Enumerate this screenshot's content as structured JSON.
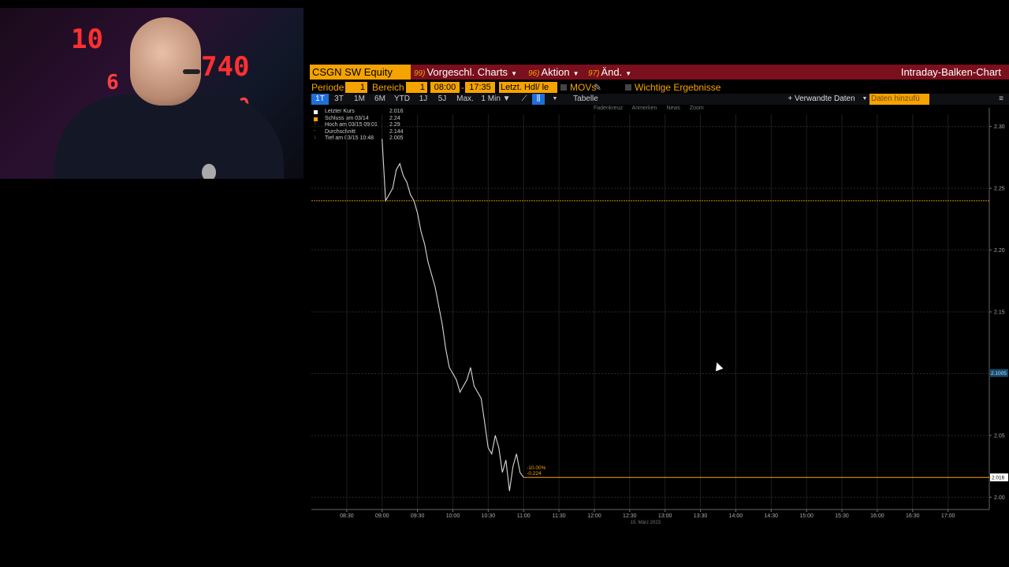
{
  "webcam": {
    "ticker_numbers": [
      "10",
      "740",
      "6",
      "130"
    ]
  },
  "toolbar": {
    "ticker": "CSGN SW Equity",
    "menus": [
      {
        "num": "99)",
        "label": "Vorgeschl. Charts"
      },
      {
        "num": "96)",
        "label": "Aktion"
      },
      {
        "num": "97)",
        "label": "Änd."
      }
    ],
    "title": "Intraday-Balken-Chart"
  },
  "settings": {
    "periode_label": "Periode",
    "periode_value": "1",
    "bereich_label": "Bereich",
    "bereich_value": "1",
    "start_time": "08:00",
    "end_time": "17:35",
    "price_field": "Letzt. Hdl/ le",
    "movs_label": "MOVs",
    "wichtige_label": "Wichtige Ergebnisse"
  },
  "timeframes": [
    "1T",
    "3T",
    "1M",
    "6M",
    "YTD",
    "1J",
    "5J",
    "Max.",
    "1 Min ▼"
  ],
  "tabelle_label": "Tabelle",
  "verwandte_label": "+ Verwandte Daten",
  "daten_label": "Daten hinzufü",
  "chart_tools": [
    "Fadenkreuz",
    "Anmerken",
    "News",
    "Zoom"
  ],
  "legend": [
    {
      "name": "Letzter Kurs",
      "value": "2.016",
      "color": "#ffffff"
    },
    {
      "name": "Schluss am 03/14",
      "value": "2.24",
      "color": "#f5a300"
    },
    {
      "name": "Hoch am 03/15 09:01",
      "value": "2.29",
      "color": "#888888"
    },
    {
      "name": "Durchschnitt",
      "value": "2.144",
      "color": "#888888"
    },
    {
      "name": "Tief am 03/15 10:48",
      "value": "2.005",
      "color": "#888888"
    }
  ],
  "chart_data": {
    "type": "line",
    "x_labels": [
      "08:30",
      "09:00",
      "09:30",
      "10:00",
      "10:30",
      "11:00",
      "11:30",
      "12:00",
      "12:30",
      "13:00",
      "13:30",
      "14:00",
      "14:30",
      "15:00",
      "15:30",
      "16:00",
      "16:30",
      "17:00"
    ],
    "y_ticks": [
      2.0,
      2.05,
      2.1,
      2.15,
      2.2,
      2.25,
      2.3
    ],
    "ylim": [
      1.99,
      2.31
    ],
    "x_range_minutes": [
      480,
      1055
    ],
    "series": [
      {
        "name": "Letzter Kurs",
        "x": [
          "09:00",
          "09:03",
          "09:06",
          "09:09",
          "09:12",
          "09:15",
          "09:18",
          "09:21",
          "09:24",
          "09:27",
          "09:30",
          "09:33",
          "09:36",
          "09:39",
          "09:42",
          "09:45",
          "09:48",
          "09:51",
          "09:54",
          "09:57",
          "10:00",
          "10:03",
          "10:06",
          "10:09",
          "10:12",
          "10:15",
          "10:18",
          "10:21",
          "10:24",
          "10:27",
          "10:30",
          "10:33",
          "10:36",
          "10:39",
          "10:42",
          "10:45",
          "10:48",
          "10:51",
          "10:54",
          "10:57",
          "11:00"
        ],
        "values": [
          2.29,
          2.24,
          2.245,
          2.25,
          2.265,
          2.27,
          2.26,
          2.255,
          2.245,
          2.24,
          2.23,
          2.215,
          2.205,
          2.19,
          2.18,
          2.17,
          2.155,
          2.14,
          2.12,
          2.105,
          2.1,
          2.095,
          2.085,
          2.09,
          2.095,
          2.105,
          2.09,
          2.085,
          2.08,
          2.06,
          2.04,
          2.035,
          2.05,
          2.04,
          2.02,
          2.03,
          2.005,
          2.025,
          2.035,
          2.02,
          2.016
        ]
      }
    ],
    "reference_lines": [
      {
        "label": "Schluss am 03/14",
        "value": 2.24,
        "color": "#f5a300"
      }
    ],
    "last_price_line": {
      "value": 2.016,
      "color": "#f5a300",
      "label": "2.016"
    },
    "cursor_value_label": "2.1005",
    "change_labels": [
      "-10.00%",
      "-0.224"
    ],
    "date_label": "15. März 2023",
    "grid": true
  }
}
